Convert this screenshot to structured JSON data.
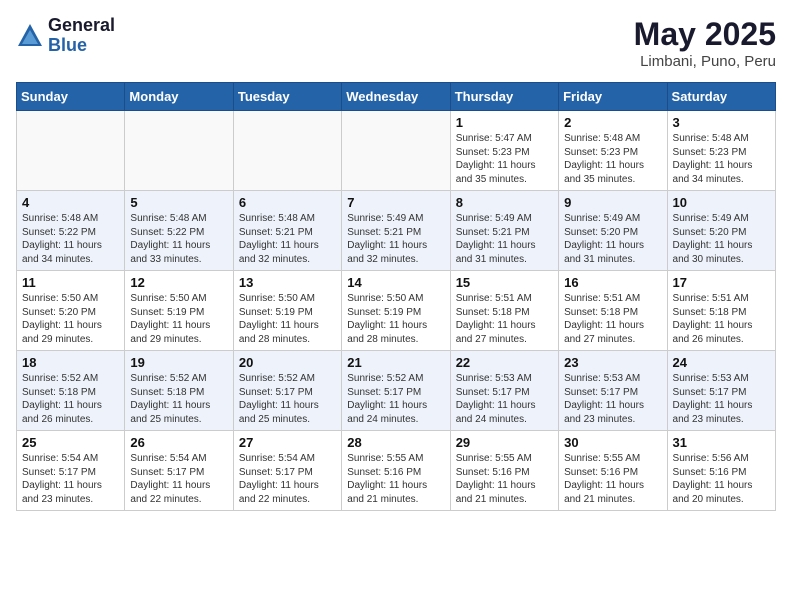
{
  "header": {
    "logo_general": "General",
    "logo_blue": "Blue",
    "title": "May 2025",
    "subtitle": "Limbani, Puno, Peru"
  },
  "days_of_week": [
    "Sunday",
    "Monday",
    "Tuesday",
    "Wednesday",
    "Thursday",
    "Friday",
    "Saturday"
  ],
  "weeks": [
    [
      {
        "day": "",
        "info": ""
      },
      {
        "day": "",
        "info": ""
      },
      {
        "day": "",
        "info": ""
      },
      {
        "day": "",
        "info": ""
      },
      {
        "day": "1",
        "info": "Sunrise: 5:47 AM\nSunset: 5:23 PM\nDaylight: 11 hours and 35 minutes."
      },
      {
        "day": "2",
        "info": "Sunrise: 5:48 AM\nSunset: 5:23 PM\nDaylight: 11 hours and 35 minutes."
      },
      {
        "day": "3",
        "info": "Sunrise: 5:48 AM\nSunset: 5:23 PM\nDaylight: 11 hours and 34 minutes."
      }
    ],
    [
      {
        "day": "4",
        "info": "Sunrise: 5:48 AM\nSunset: 5:22 PM\nDaylight: 11 hours and 34 minutes."
      },
      {
        "day": "5",
        "info": "Sunrise: 5:48 AM\nSunset: 5:22 PM\nDaylight: 11 hours and 33 minutes."
      },
      {
        "day": "6",
        "info": "Sunrise: 5:48 AM\nSunset: 5:21 PM\nDaylight: 11 hours and 32 minutes."
      },
      {
        "day": "7",
        "info": "Sunrise: 5:49 AM\nSunset: 5:21 PM\nDaylight: 11 hours and 32 minutes."
      },
      {
        "day": "8",
        "info": "Sunrise: 5:49 AM\nSunset: 5:21 PM\nDaylight: 11 hours and 31 minutes."
      },
      {
        "day": "9",
        "info": "Sunrise: 5:49 AM\nSunset: 5:20 PM\nDaylight: 11 hours and 31 minutes."
      },
      {
        "day": "10",
        "info": "Sunrise: 5:49 AM\nSunset: 5:20 PM\nDaylight: 11 hours and 30 minutes."
      }
    ],
    [
      {
        "day": "11",
        "info": "Sunrise: 5:50 AM\nSunset: 5:20 PM\nDaylight: 11 hours and 29 minutes."
      },
      {
        "day": "12",
        "info": "Sunrise: 5:50 AM\nSunset: 5:19 PM\nDaylight: 11 hours and 29 minutes."
      },
      {
        "day": "13",
        "info": "Sunrise: 5:50 AM\nSunset: 5:19 PM\nDaylight: 11 hours and 28 minutes."
      },
      {
        "day": "14",
        "info": "Sunrise: 5:50 AM\nSunset: 5:19 PM\nDaylight: 11 hours and 28 minutes."
      },
      {
        "day": "15",
        "info": "Sunrise: 5:51 AM\nSunset: 5:18 PM\nDaylight: 11 hours and 27 minutes."
      },
      {
        "day": "16",
        "info": "Sunrise: 5:51 AM\nSunset: 5:18 PM\nDaylight: 11 hours and 27 minutes."
      },
      {
        "day": "17",
        "info": "Sunrise: 5:51 AM\nSunset: 5:18 PM\nDaylight: 11 hours and 26 minutes."
      }
    ],
    [
      {
        "day": "18",
        "info": "Sunrise: 5:52 AM\nSunset: 5:18 PM\nDaylight: 11 hours and 26 minutes."
      },
      {
        "day": "19",
        "info": "Sunrise: 5:52 AM\nSunset: 5:18 PM\nDaylight: 11 hours and 25 minutes."
      },
      {
        "day": "20",
        "info": "Sunrise: 5:52 AM\nSunset: 5:17 PM\nDaylight: 11 hours and 25 minutes."
      },
      {
        "day": "21",
        "info": "Sunrise: 5:52 AM\nSunset: 5:17 PM\nDaylight: 11 hours and 24 minutes."
      },
      {
        "day": "22",
        "info": "Sunrise: 5:53 AM\nSunset: 5:17 PM\nDaylight: 11 hours and 24 minutes."
      },
      {
        "day": "23",
        "info": "Sunrise: 5:53 AM\nSunset: 5:17 PM\nDaylight: 11 hours and 23 minutes."
      },
      {
        "day": "24",
        "info": "Sunrise: 5:53 AM\nSunset: 5:17 PM\nDaylight: 11 hours and 23 minutes."
      }
    ],
    [
      {
        "day": "25",
        "info": "Sunrise: 5:54 AM\nSunset: 5:17 PM\nDaylight: 11 hours and 23 minutes."
      },
      {
        "day": "26",
        "info": "Sunrise: 5:54 AM\nSunset: 5:17 PM\nDaylight: 11 hours and 22 minutes."
      },
      {
        "day": "27",
        "info": "Sunrise: 5:54 AM\nSunset: 5:17 PM\nDaylight: 11 hours and 22 minutes."
      },
      {
        "day": "28",
        "info": "Sunrise: 5:55 AM\nSunset: 5:16 PM\nDaylight: 11 hours and 21 minutes."
      },
      {
        "day": "29",
        "info": "Sunrise: 5:55 AM\nSunset: 5:16 PM\nDaylight: 11 hours and 21 minutes."
      },
      {
        "day": "30",
        "info": "Sunrise: 5:55 AM\nSunset: 5:16 PM\nDaylight: 11 hours and 21 minutes."
      },
      {
        "day": "31",
        "info": "Sunrise: 5:56 AM\nSunset: 5:16 PM\nDaylight: 11 hours and 20 minutes."
      }
    ]
  ]
}
